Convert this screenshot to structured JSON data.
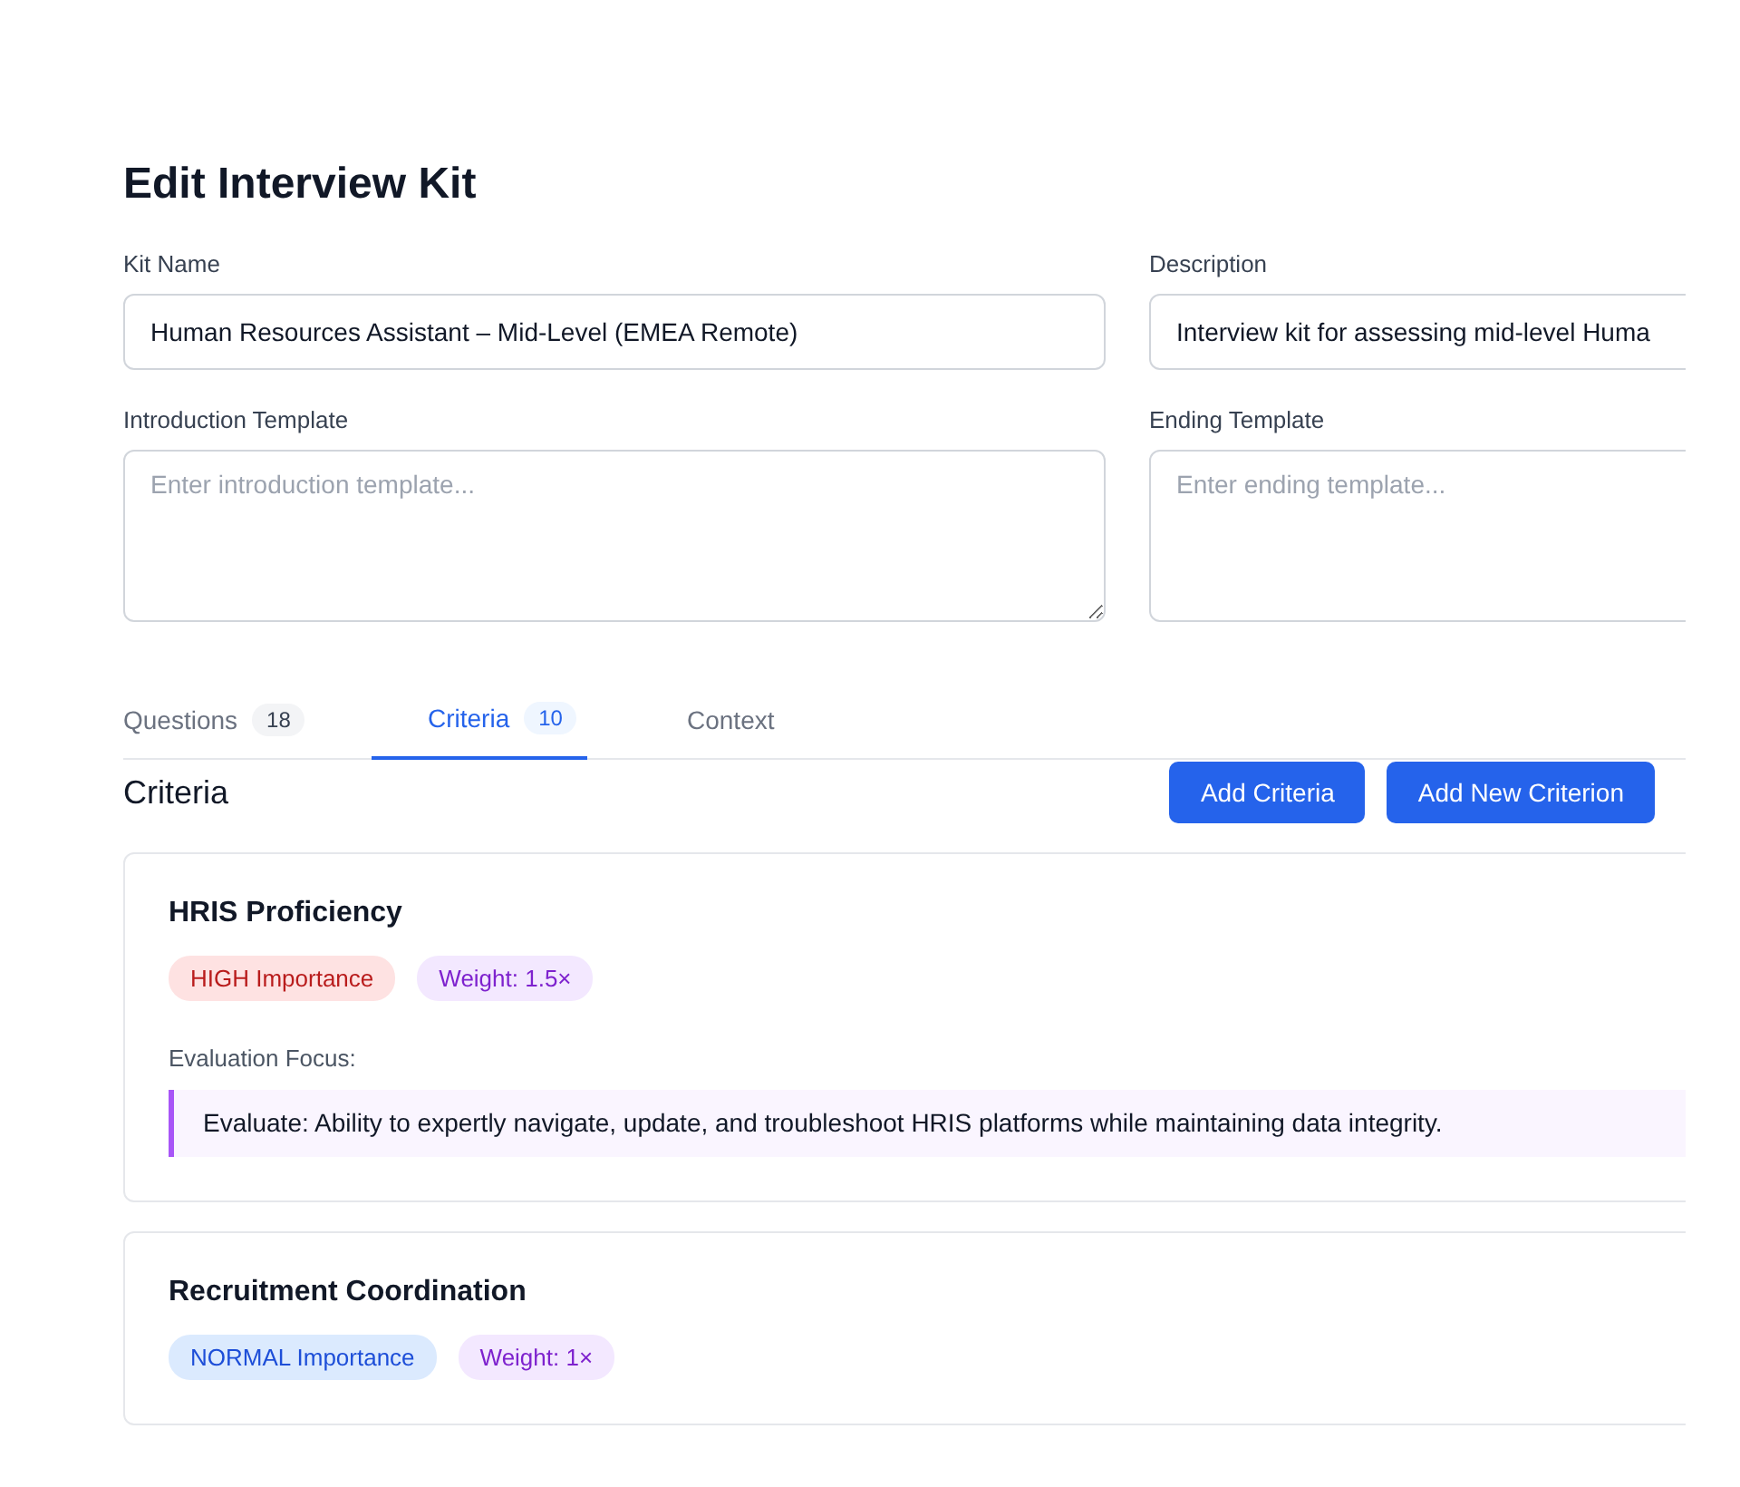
{
  "page_title": "Edit Interview Kit",
  "fields": [
    {
      "label": "Kit Name",
      "kind": "input",
      "value": "Human Resources Assistant – Mid-Level (EMEA Remote)"
    },
    {
      "label": "Description",
      "kind": "input",
      "value": "Interview kit for assessing mid-level Huma"
    },
    {
      "label": "Introduction Template",
      "kind": "textarea",
      "placeholder": "Enter introduction template..."
    },
    {
      "label": "Ending Template",
      "kind": "textarea",
      "placeholder": "Enter ending template..."
    }
  ],
  "tabs": [
    {
      "label": "Questions",
      "count": "18",
      "selected": false
    },
    {
      "label": "Criteria",
      "count": "10",
      "selected": true
    },
    {
      "label": "Context",
      "selected": false
    }
  ],
  "section_title": "Criteria",
  "buttons": [
    "Add Criteria",
    "Add New Criterion"
  ],
  "criteria": [
    {
      "name": "HRIS Proficiency",
      "importance": "HIGH Importance",
      "kind": "high",
      "weight": "Weight: 1.5×",
      "focus_label": "Evaluation Focus:",
      "focus": "Evaluate: Ability to expertly navigate, update, and troubleshoot HRIS platforms while maintaining data integrity."
    },
    {
      "name": "Recruitment Coordination",
      "importance": "NORMAL Importance",
      "kind": "normal",
      "weight": "Weight: 1×"
    }
  ]
}
